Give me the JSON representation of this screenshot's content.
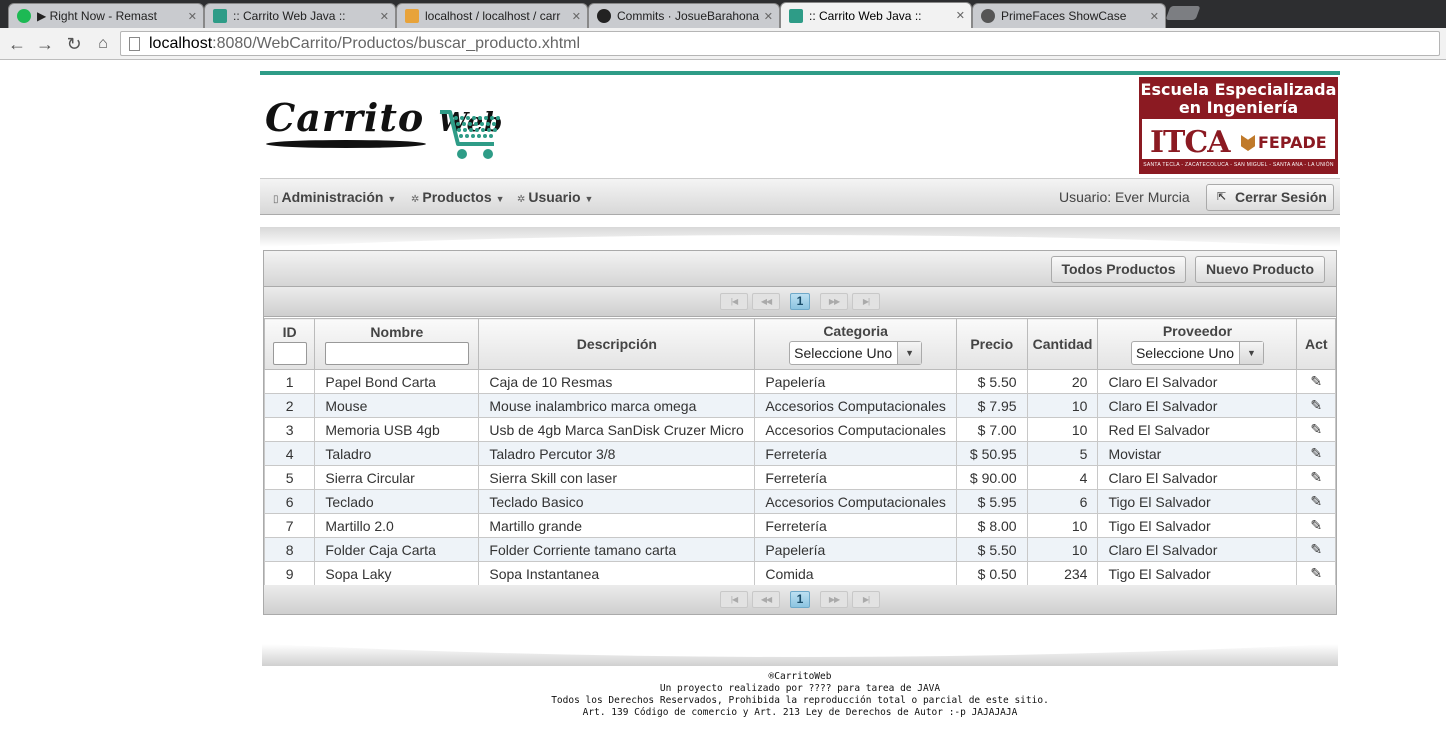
{
  "browser": {
    "tabs": [
      {
        "title": "▶ Right Now - Remast",
        "icon": "spotify-icon",
        "color": "#1db954",
        "left": 0
      },
      {
        "title": ":: Carrito Web Java ::",
        "icon": "cart-favicon",
        "color": "#2e9c87",
        "left": 0
      },
      {
        "title": "localhost / localhost / carr",
        "icon": "phpmyadmin-icon",
        "color": "#e8a33a",
        "left": 0
      },
      {
        "title": "Commits · JosueBarahona",
        "icon": "github-icon",
        "color": "#222222",
        "left": 0
      },
      {
        "title": ":: Carrito Web Java ::",
        "icon": "cart-favicon",
        "color": "#2e9c87",
        "left": 0
      },
      {
        "title": "PrimeFaces ShowCase",
        "icon": "primefaces-icon",
        "color": "#555555",
        "left": 0
      }
    ],
    "url_host": "localhost",
    "url_path": ":8080/WebCarrito/Productos/buscar_producto.xhtml"
  },
  "header": {
    "logo_word1": "Carrito",
    "logo_word2": "Web",
    "itca_line1": "Escuela Especializada",
    "itca_line2": "en Ingeniería",
    "itca_name": "ITCA",
    "fepade": "FEPADE",
    "itca_strip": "SANTA TECLA - ZACATECOLUCA - SAN MIGUEL - SANTA ANA - LA UNIÓN"
  },
  "menu": {
    "items": [
      "Administración",
      "Productos",
      "Usuario"
    ],
    "user": "Usuario: Ever Murcia",
    "logout": "Cerrar Sesión"
  },
  "table": {
    "buttons": {
      "todos": "Todos Productos",
      "nuevo": "Nuevo Producto"
    },
    "current_page": "1",
    "columns": {
      "id": "ID",
      "nombre": "Nombre",
      "descripcion": "Descripción",
      "categoria": "Categoria",
      "precio": "Precio",
      "cantidad": "Cantidad",
      "proveedor": "Proveedor",
      "act": "Act"
    },
    "select_placeholder": "Seleccione Uno",
    "rows": [
      {
        "id": "1",
        "nombre": "Papel Bond Carta",
        "descripcion": "Caja de 10 Resmas",
        "categoria": "Papelería",
        "precio": "$ 5.50",
        "cantidad": "20",
        "proveedor": "Claro El Salvador"
      },
      {
        "id": "2",
        "nombre": "Mouse",
        "descripcion": "Mouse inalambrico marca omega",
        "categoria": "Accesorios Computacionales",
        "precio": "$ 7.95",
        "cantidad": "10",
        "proveedor": "Claro El Salvador"
      },
      {
        "id": "3",
        "nombre": "Memoria USB 4gb",
        "descripcion": "Usb de 4gb Marca SanDisk Cruzer Micro",
        "categoria": "Accesorios Computacionales",
        "precio": "$ 7.00",
        "cantidad": "10",
        "proveedor": "Red El Salvador"
      },
      {
        "id": "4",
        "nombre": "Taladro",
        "descripcion": "Taladro Percutor 3/8",
        "categoria": "Ferretería",
        "precio": "$ 50.95",
        "cantidad": "5",
        "proveedor": "Movistar"
      },
      {
        "id": "5",
        "nombre": "Sierra Circular",
        "descripcion": "Sierra Skill con laser",
        "categoria": "Ferretería",
        "precio": "$ 90.00",
        "cantidad": "4",
        "proveedor": "Claro El Salvador"
      },
      {
        "id": "6",
        "nombre": "Teclado",
        "descripcion": "Teclado Basico",
        "categoria": "Accesorios Computacionales",
        "precio": "$ 5.95",
        "cantidad": "6",
        "proveedor": "Tigo El Salvador"
      },
      {
        "id": "7",
        "nombre": "Martillo 2.0",
        "descripcion": "Martillo grande",
        "categoria": "Ferretería",
        "precio": "$ 8.00",
        "cantidad": "10",
        "proveedor": "Tigo El Salvador"
      },
      {
        "id": "8",
        "nombre": "Folder Caja Carta",
        "descripcion": "Folder Corriente tamano carta",
        "categoria": "Papelería",
        "precio": "$ 5.50",
        "cantidad": "10",
        "proveedor": "Claro El Salvador"
      },
      {
        "id": "9",
        "nombre": "Sopa Laky",
        "descripcion": "Sopa Instantanea",
        "categoria": "Comida",
        "precio": "$ 0.50",
        "cantidad": "234",
        "proveedor": "Tigo El Salvador"
      }
    ]
  },
  "footer": {
    "line1": "®CarritoWeb",
    "line2": "Un proyecto realizado por ???? para tarea de JAVA",
    "line3": "Todos los Derechos Reservados, Prohibida la reproducción total o parcial de este sitio.",
    "line4": "Art. 139 Código de comercio y Art. 213 Ley de Derechos de Autor :-p JAJAJAJA"
  },
  "colors": {
    "accent": "#2e9c87",
    "itca_red": "#8b1a22"
  }
}
